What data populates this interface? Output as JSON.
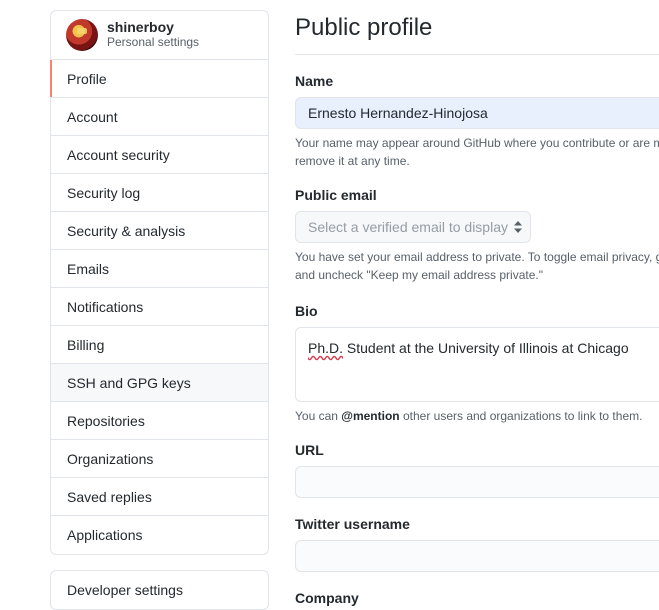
{
  "sidebar": {
    "user_name": "shinerboy",
    "user_subtitle": "Personal settings",
    "items": [
      {
        "label": "Profile"
      },
      {
        "label": "Account"
      },
      {
        "label": "Account security"
      },
      {
        "label": "Security log"
      },
      {
        "label": "Security & analysis"
      },
      {
        "label": "Emails"
      },
      {
        "label": "Notifications"
      },
      {
        "label": "Billing"
      },
      {
        "label": "SSH and GPG keys"
      },
      {
        "label": "Repositories"
      },
      {
        "label": "Organizations"
      },
      {
        "label": "Saved replies"
      },
      {
        "label": "Applications"
      }
    ],
    "developer_settings": "Developer settings"
  },
  "main": {
    "title": "Public profile",
    "name": {
      "label": "Name",
      "value": "Ernesto Hernandez-Hinojosa",
      "note_line1": "Your name may appear around GitHub where you contribute or are m",
      "note_line2": "remove it at any time."
    },
    "public_email": {
      "label": "Public email",
      "selected": "Select a verified email to display",
      "note_line1": "You have set your email address to private. To toggle email privacy, g",
      "note_line2": "and uncheck \"Keep my email address private.\""
    },
    "bio": {
      "label": "Bio",
      "value_misspelled": "Ph.D.",
      "value_rest": " Student at the University of Illinois at Chicago",
      "note_prefix": "You can ",
      "note_mention": "@mention",
      "note_suffix": " other users and organizations to link to them."
    },
    "url": {
      "label": "URL",
      "value": ""
    },
    "twitter": {
      "label": "Twitter username",
      "value": ""
    },
    "company": {
      "label": "Company"
    }
  },
  "colors": {
    "selected_indicator": "#f9826c",
    "border": "#e1e4e8",
    "muted_text": "#586069",
    "autofill_bg": "#e8f0fe"
  }
}
